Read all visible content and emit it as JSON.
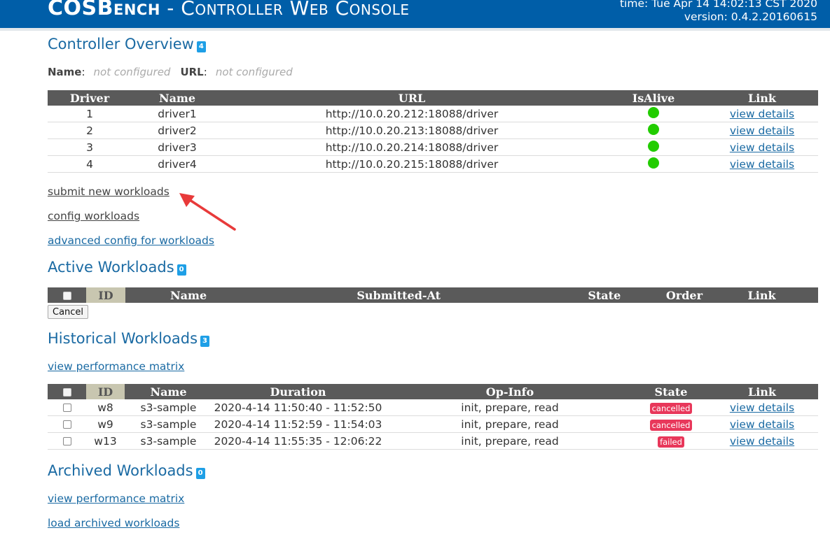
{
  "header": {
    "brand_main": "COSBench",
    "brand_rest": " - Controller Web Console",
    "time": "time: Tue Apr 14 14:02:13 CST 2020",
    "version": "version: 0.4.2.20160615"
  },
  "overview": {
    "title": "Controller Overview",
    "count": "4",
    "name_label": "Name",
    "name_value": "not configured",
    "url_label": "URL",
    "url_value": "not configured",
    "columns": [
      "Driver",
      "Name",
      "URL",
      "IsAlive",
      "Link"
    ],
    "drivers": [
      {
        "id": "1",
        "name": "driver1",
        "url": "http://10.0.20.212:18088/driver",
        "alive": true,
        "link": "view details"
      },
      {
        "id": "2",
        "name": "driver2",
        "url": "http://10.0.20.213:18088/driver",
        "alive": true,
        "link": "view details"
      },
      {
        "id": "3",
        "name": "driver3",
        "url": "http://10.0.20.214:18088/driver",
        "alive": true,
        "link": "view details"
      },
      {
        "id": "4",
        "name": "driver4",
        "url": "http://10.0.20.215:18088/driver",
        "alive": true,
        "link": "view details"
      }
    ]
  },
  "links": {
    "submit": "submit new workloads",
    "config": "config workloads",
    "advanced": "advanced config for workloads"
  },
  "active": {
    "title": "Active Workloads",
    "count": "0",
    "columns": [
      "ID",
      "Name",
      "Submitted-At",
      "State",
      "Order",
      "Link"
    ],
    "cancel_label": "Cancel"
  },
  "historical": {
    "title": "Historical Workloads",
    "count": "3",
    "perf_link": "view performance matrix",
    "columns": [
      "ID",
      "Name",
      "Duration",
      "Op-Info",
      "State",
      "Link"
    ],
    "rows": [
      {
        "id": "w8",
        "name": "s3-sample",
        "duration": "2020-4-14 11:50:40 - 11:52:50",
        "opinfo": "init, prepare, read",
        "state": "cancelled",
        "link": "view details"
      },
      {
        "id": "w9",
        "name": "s3-sample",
        "duration": "2020-4-14 11:52:59 - 11:54:03",
        "opinfo": "init, prepare, read",
        "state": "cancelled",
        "link": "view details"
      },
      {
        "id": "w13",
        "name": "s3-sample",
        "duration": "2020-4-14 11:55:35 - 12:06:22",
        "opinfo": "init, prepare, read",
        "state": "failed",
        "link": "view details"
      }
    ]
  },
  "archived": {
    "title": "Archived Workloads",
    "count": "0",
    "perf_link": "view performance matrix",
    "load_link": "load archived workloads"
  },
  "colors": {
    "header_bg": "#005ea8",
    "title": "#1a6aa3",
    "alive": "#22cc00",
    "state_badge": "#e8375a",
    "annotation_arrow": "#e83a3a"
  }
}
